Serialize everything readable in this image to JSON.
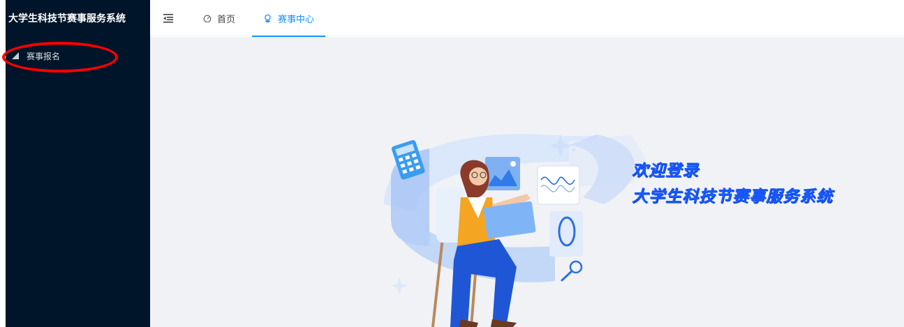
{
  "app": {
    "title": "大学生科技节赛事服务系统"
  },
  "sidebar": {
    "items": [
      {
        "label": "赛事报名",
        "icon": "chart-pie-icon"
      }
    ]
  },
  "topnav": {
    "collapse_icon": "menu-fold-icon",
    "tabs": [
      {
        "label": "首页",
        "icon": "dashboard-icon",
        "active": false
      },
      {
        "label": "赛事中心",
        "icon": "trophy-icon",
        "active": true
      }
    ]
  },
  "welcome": {
    "line1": "欢迎登录",
    "line2": "大学生科技节赛事服务系统"
  },
  "colors": {
    "sidebar_bg": "#001529",
    "accent": "#1890ff",
    "content_bg": "#f0f2f5",
    "welcome_text": "#1859ff",
    "annotation": "#ff0000"
  }
}
